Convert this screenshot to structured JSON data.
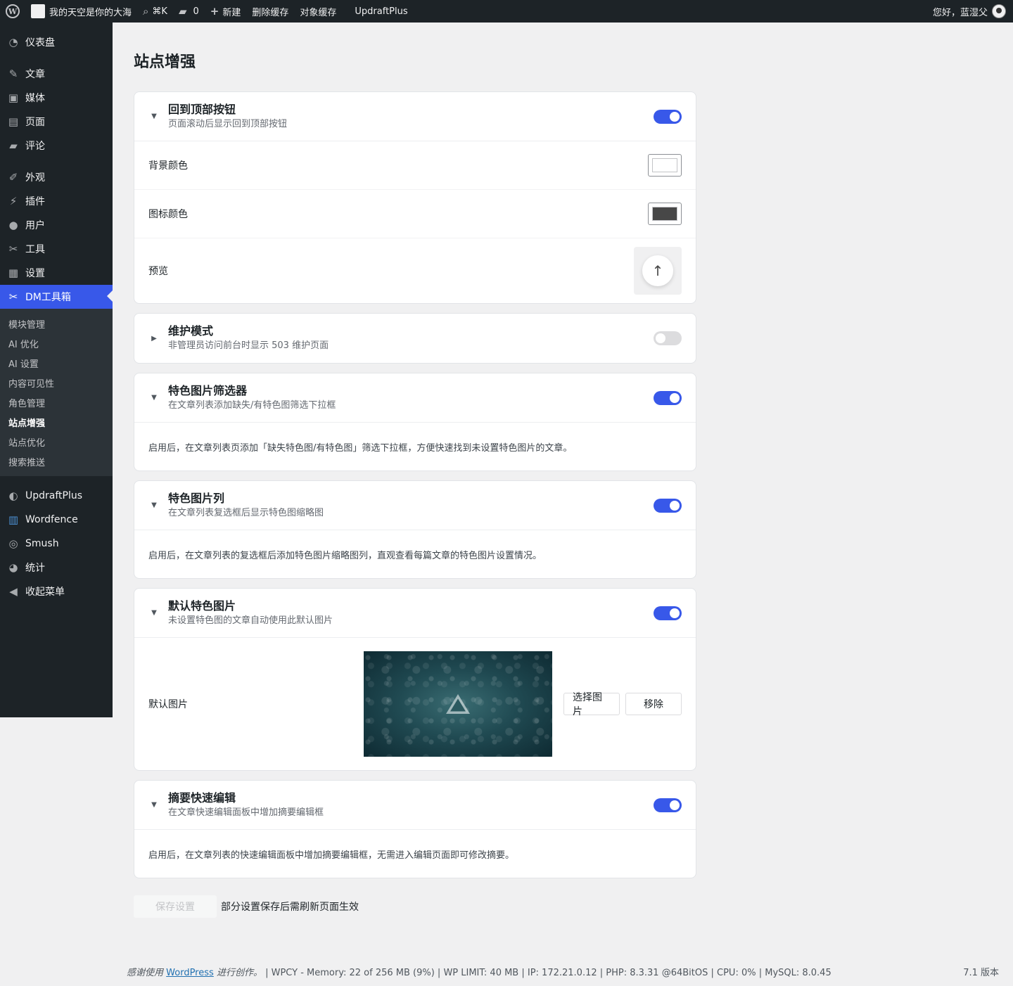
{
  "adminbar": {
    "site_name": "我的天空是你的大海",
    "search_shortcut": "⌘K",
    "comments_count": "0",
    "new_label": "新建",
    "clear_cache": "删除缓存",
    "object_cache": "对象缓存",
    "updraftplus": "UpdraftPlus",
    "greeting": "您好，蓝湿父"
  },
  "sidebar": {
    "dashboard": "仪表盘",
    "posts": "文章",
    "media": "媒体",
    "pages": "页面",
    "comments": "评论",
    "appearance": "外观",
    "plugins": "插件",
    "users": "用户",
    "tools": "工具",
    "settings": "设置",
    "dm_toolbox": "DM工具箱",
    "submenu": [
      "模块管理",
      "AI 优化",
      "AI 设置",
      "内容可见性",
      "角色管理",
      "站点增强",
      "站点优化",
      "搜索推送"
    ],
    "updraftplus": "UpdraftPlus",
    "wordfence": "Wordfence",
    "smush": "Smush",
    "stats": "统计",
    "collapse": "收起菜单"
  },
  "page": {
    "title": "站点增强"
  },
  "cards": {
    "back_to_top": {
      "title": "回到顶部按钮",
      "desc": "页面滚动后显示回到顶部按钮",
      "enabled": true,
      "bg_color_label": "背景颜色",
      "bg_color": "#ffffff",
      "icon_color_label": "图标颜色",
      "icon_color": "#474747",
      "preview_label": "预览"
    },
    "maintenance": {
      "title": "维护模式",
      "desc": "非管理员访问前台时显示 503 维护页面",
      "enabled": false
    },
    "thumb_filter": {
      "title": "特色图片筛选器",
      "desc": "在文章列表添加缺失/有特色图筛选下拉框",
      "enabled": true,
      "info": "启用后，在文章列表页添加「缺失特色图/有特色图」筛选下拉框，方便快速找到未设置特色图片的文章。"
    },
    "thumb_column": {
      "title": "特色图片列",
      "desc": "在文章列表复选框后显示特色图缩略图",
      "enabled": true,
      "info": "启用后，在文章列表的复选框后添加特色图片缩略图列，直观查看每篇文章的特色图片设置情况。"
    },
    "default_thumb": {
      "title": "默认特色图片",
      "desc": "未设置特色图的文章自动使用此默认图片",
      "enabled": true,
      "image_label": "默认图片",
      "choose": "选择图片",
      "remove": "移除"
    },
    "excerpt_edit": {
      "title": "摘要快速编辑",
      "desc": "在文章快速编辑面板中增加摘要编辑框",
      "enabled": true,
      "info": "启用后，在文章列表的快速编辑面板中增加摘要编辑框，无需进入编辑页面即可修改摘要。"
    }
  },
  "save": {
    "button": "保存设置",
    "note": "部分设置保存后需刷新页面生效"
  },
  "footer": {
    "thanks_prefix": "感谢使用",
    "wordpress": "WordPress",
    "thanks_suffix": "进行创作。",
    "stats": " | WPCY - Memory: 22 of 256 MB (9%) | WP LIMIT: 40 MB | IP: 172.21.0.12 | PHP: 8.3.31 @64BitOS | CPU: 0% | MySQL: 8.0.45",
    "version": "7.1 版本"
  },
  "colors": {
    "accent": "#3858e9",
    "adminbar_bg": "#1d2327"
  }
}
